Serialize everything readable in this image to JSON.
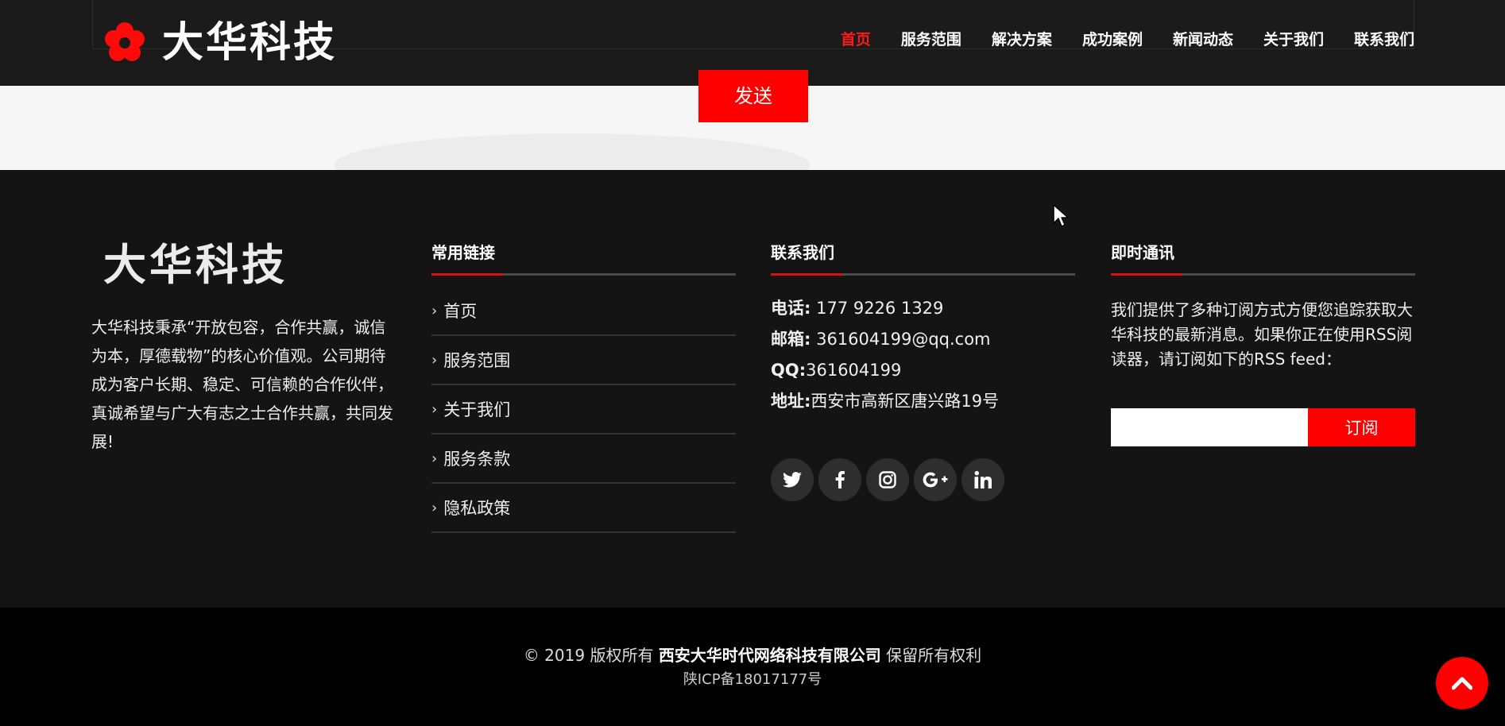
{
  "header": {
    "logo_text": "大华科技",
    "nav": [
      "首页",
      "服务范围",
      "解决方案",
      "成功案例",
      "新闻动态",
      "关于我们",
      "联系我们"
    ],
    "active_nav": "首页"
  },
  "form": {
    "send_label": "发送"
  },
  "footer": {
    "brand": "大华科技",
    "about": "大华科技秉承“开放包容，合作共赢，诚信为本，厚德载物”的核心价值观。公司期待成为客户长期、稳定、可信赖的合作伙伴，真诚希望与广大有志之士合作共赢，共同发展!",
    "links": {
      "title": "常用链接",
      "items": [
        "首页",
        "服务范围",
        "关于我们",
        "服务条款",
        "隐私政策"
      ]
    },
    "contact": {
      "title": "联系我们",
      "phone_label": "电话:",
      "phone": " 177 9226 1329",
      "email_label": "邮箱:",
      "email": " 361604199@qq.com",
      "qq_label": "QQ:",
      "qq": "361604199",
      "address_label": "地址:",
      "address": "西安市高新区唐兴路19号",
      "socials": [
        "twitter-icon",
        "facebook-icon",
        "instagram-icon",
        "google-plus-icon",
        "linkedin-icon"
      ]
    },
    "newsletter": {
      "title": "即时通讯",
      "text": "我们提供了多种订阅方式方便您追踪获取大华科技的最新消息。如果你正在使用RSS阅读器，请订阅如下的RSS feed：",
      "input_value": "",
      "button_label": "订阅"
    }
  },
  "bottom": {
    "copyright_prefix": "© 2019 版权所有 ",
    "company": "西安大华时代网络科技有限公司",
    "copyright_suffix": " 保留所有权利",
    "icp": "陕ICP备18017177号"
  },
  "colors": {
    "accent": "#ff0000",
    "header_bg": "#1a1a1a",
    "footer_bg": "#141414",
    "bottom_bg": "#000000"
  }
}
